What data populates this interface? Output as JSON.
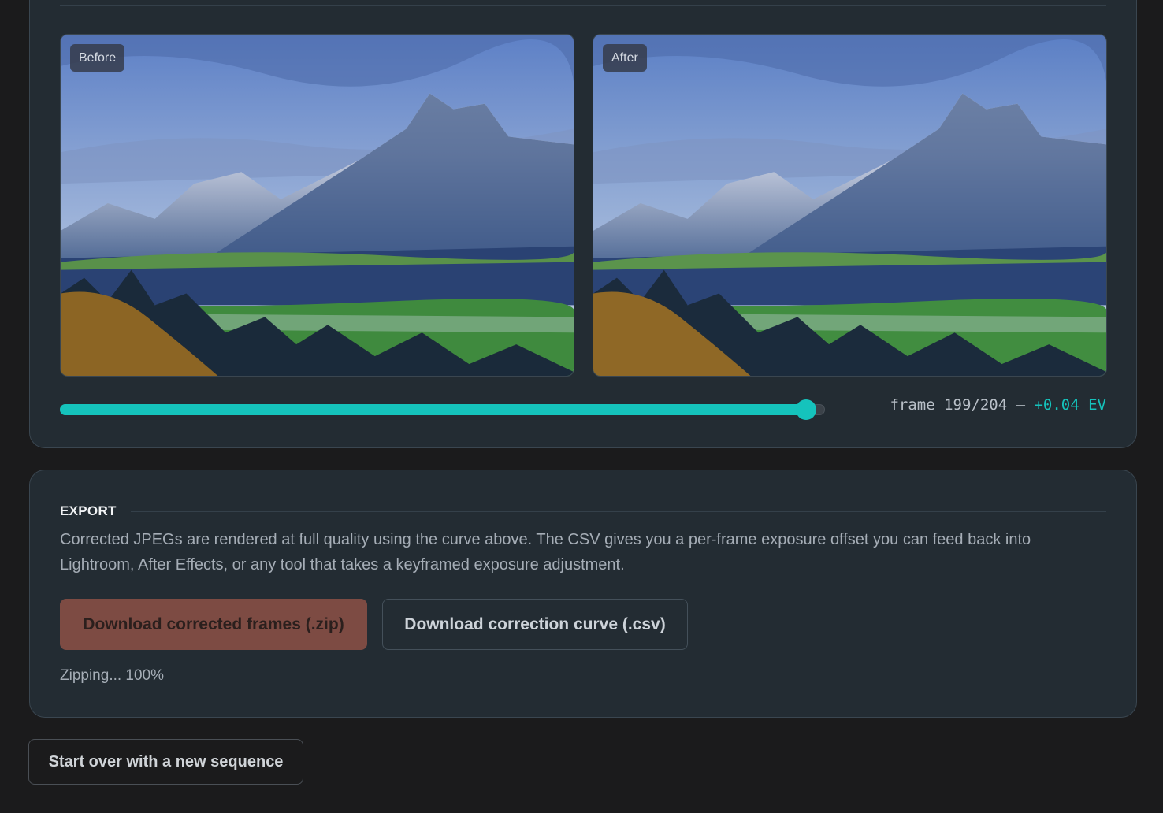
{
  "preview": {
    "before_label": "Before",
    "after_label": "After",
    "slider": {
      "value": 199,
      "max": 204
    },
    "frame_text": "frame 199/204 —",
    "ev_text": "+0.04 EV"
  },
  "export": {
    "title": "EXPORT",
    "description": "Corrected JPEGs are rendered at full quality using the curve above. The CSV gives you a per-frame exposure offset you can feed back into Lightroom, After Effects, or any tool that takes a keyframed exposure adjustment.",
    "zip_button": "Download corrected frames (.zip)",
    "csv_button": "Download correction curve (.csv)",
    "status": "Zipping... 100%"
  },
  "footer": {
    "start_over": "Start over with a new sequence"
  },
  "colors": {
    "accent": "#15c3bc",
    "zip_button": "#7d4b43",
    "card": "#232c33",
    "page": "#1b1b1c"
  }
}
